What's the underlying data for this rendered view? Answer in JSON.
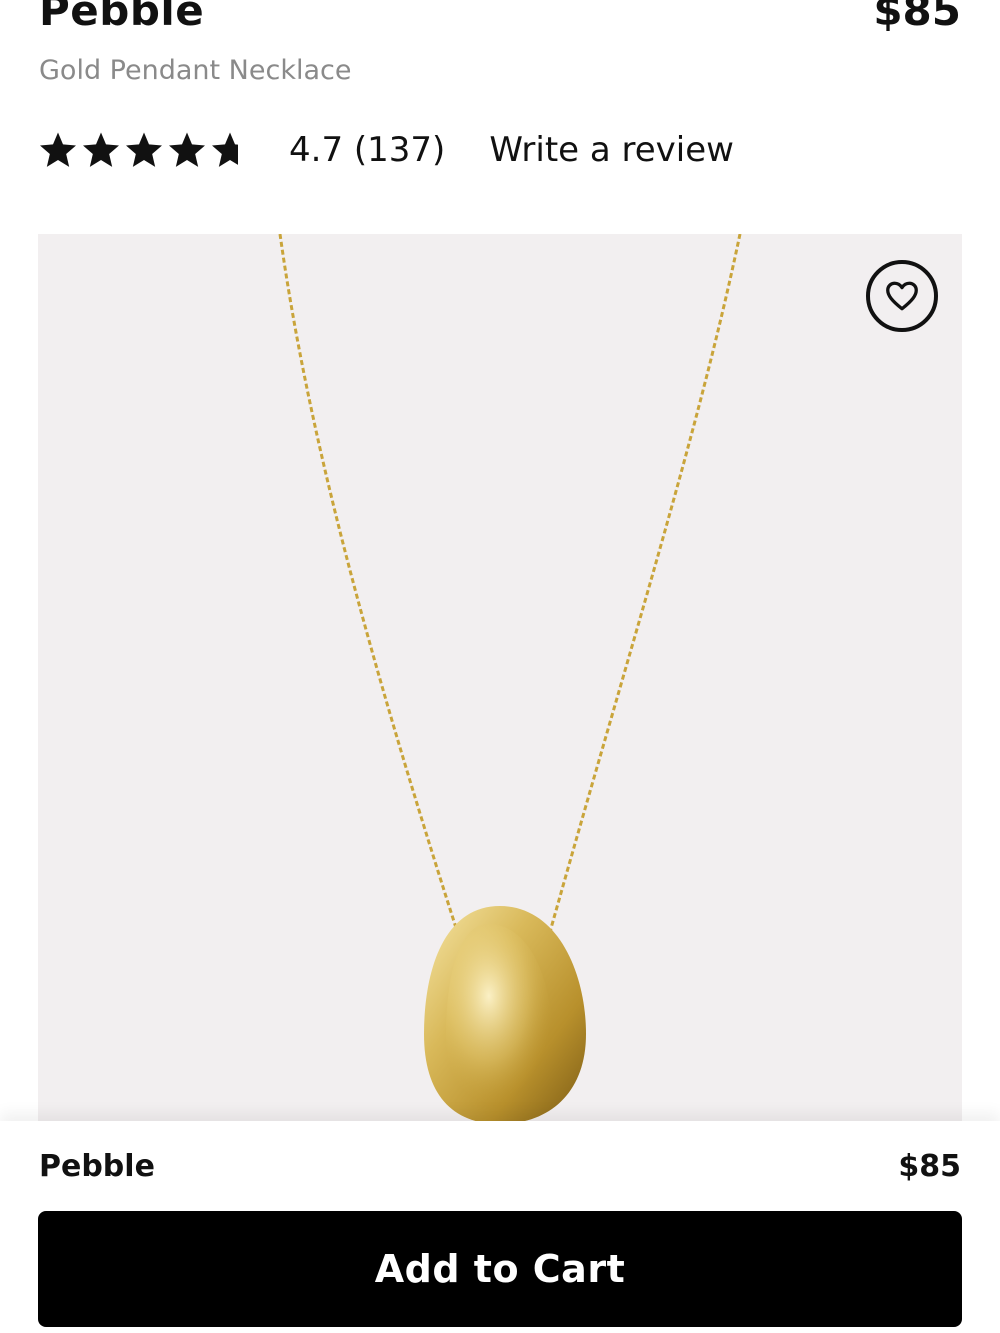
{
  "product": {
    "name": "Pebble",
    "price": "$85",
    "subtitle": "Gold Pendant Necklace"
  },
  "rating": {
    "value": 4.7,
    "display": "4.7 (137)",
    "count": 137,
    "max_stars": 5,
    "icon": "star-icon"
  },
  "review_link": "Write a review",
  "image": {
    "subject": "gold pebble pendant on chain",
    "background_color": "#f2eff0"
  },
  "wishlist": {
    "icon": "heart-icon"
  },
  "sticky_bar": {
    "name": "Pebble",
    "price": "$85",
    "cta_label": "Add to Cart"
  },
  "colors": {
    "text": "#111111",
    "subtitle": "#8a8a8a",
    "cta_background": "#000000",
    "cta_text": "#ffffff",
    "gold": "#c9a43a"
  }
}
